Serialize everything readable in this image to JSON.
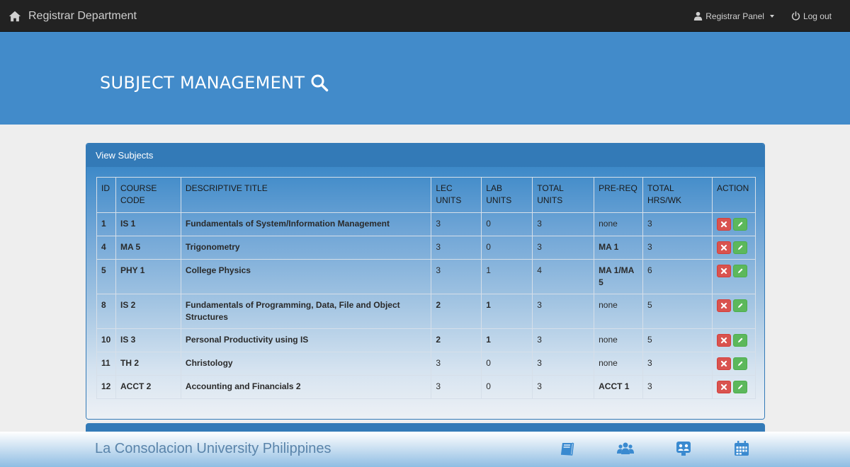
{
  "navbar": {
    "brand": "Registrar Department",
    "panel_menu": "Registrar Panel",
    "logout": "Log out"
  },
  "banner": {
    "title": "SUBJECT MANAGEMENT"
  },
  "panel": {
    "heading": "View Subjects",
    "columns": {
      "id": "ID",
      "course_code_1": "COURSE",
      "course_code_2": "CODE",
      "title": "DESCRIPTIVE TITLE",
      "lec_1": "LEC",
      "lec_2": "UNITS",
      "lab_1": "LAB",
      "lab_2": "UNITS",
      "total_1": "TOTAL",
      "total_2": "UNITS",
      "prereq": "PRE-REQ",
      "hrs_1": "TOTAL",
      "hrs_2": "HRS/WK",
      "action": "ACTION"
    },
    "rows": [
      {
        "id": "1",
        "code": "IS 1",
        "title": "Fundamentals of System/Information Management",
        "lec": "3",
        "lab": "0",
        "total": "3",
        "prereq": "none",
        "hrs": "3"
      },
      {
        "id": "4",
        "code": "MA 5",
        "title": "Trigonometry",
        "lec": "3",
        "lab": "0",
        "total": "3",
        "prereq": "MA 1",
        "hrs": "3"
      },
      {
        "id": "5",
        "code": "PHY 1",
        "title": "College Physics",
        "lec": "3",
        "lab": "1",
        "total": "4",
        "prereq": "MA 1/MA 5",
        "hrs": "6"
      },
      {
        "id": "8",
        "code": "IS 2",
        "title": "Fundamentals of Programming, Data, File and Object Structures",
        "lec": "2",
        "lab": "1",
        "total": "3",
        "prereq": "none",
        "hrs": "5"
      },
      {
        "id": "10",
        "code": "IS 3",
        "title": "Personal Productivity using IS",
        "lec": "2",
        "lab": "1",
        "total": "3",
        "prereq": "none",
        "hrs": "5"
      },
      {
        "id": "11",
        "code": "TH 2",
        "title": "Christology",
        "lec": "3",
        "lab": "0",
        "total": "3",
        "prereq": "none",
        "hrs": "3"
      },
      {
        "id": "12",
        "code": "ACCT 2",
        "title": "Accounting and Financials 2",
        "lec": "3",
        "lab": "0",
        "total": "3",
        "prereq": "ACCT 1",
        "hrs": "3"
      }
    ]
  },
  "footer": {
    "title": "La Consolacion University Philippines",
    "icons": [
      "book-icon",
      "users-icon",
      "group-icon",
      "calendar-icon"
    ]
  },
  "colors": {
    "navbar": "#222222",
    "banner": "#428bca",
    "panel_heading": "#337ab7",
    "delete": "#d9534f",
    "edit": "#5cb85c"
  }
}
